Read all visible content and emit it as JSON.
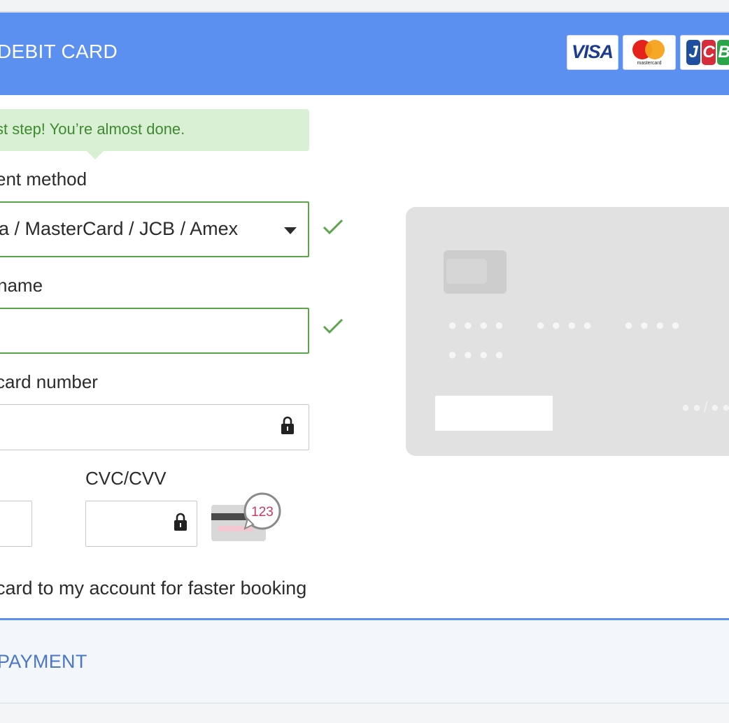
{
  "header": {
    "title": "DEBIT CARD",
    "logos": [
      "VISA",
      "mastercard",
      "JCB"
    ],
    "bg_color": "#5b8ff0"
  },
  "tooltip": {
    "text": "st step! You’re almost done."
  },
  "payment_method": {
    "label": "ent method",
    "value": "a / MasterCard / JCB / Amex",
    "status": "valid"
  },
  "cardholder_name": {
    "label": "name",
    "value": "",
    "status": "valid"
  },
  "card_number": {
    "label": "card number",
    "value": ""
  },
  "cvc": {
    "label": "CVC/CVV",
    "value": "",
    "hint_number": "123"
  },
  "save_card": {
    "label": "card to my account for faster booking"
  },
  "card_preview": {
    "number_groups": [
      "●●●●",
      "●●●●",
      "●●●●",
      "●●●●"
    ],
    "expiry_placeholder": "●●/●●"
  },
  "footer": {
    "title": "PAYMENT"
  },
  "colors": {
    "valid": "#5da54d",
    "accent": "#5b8ff0",
    "footer_text": "#4a78c6"
  }
}
